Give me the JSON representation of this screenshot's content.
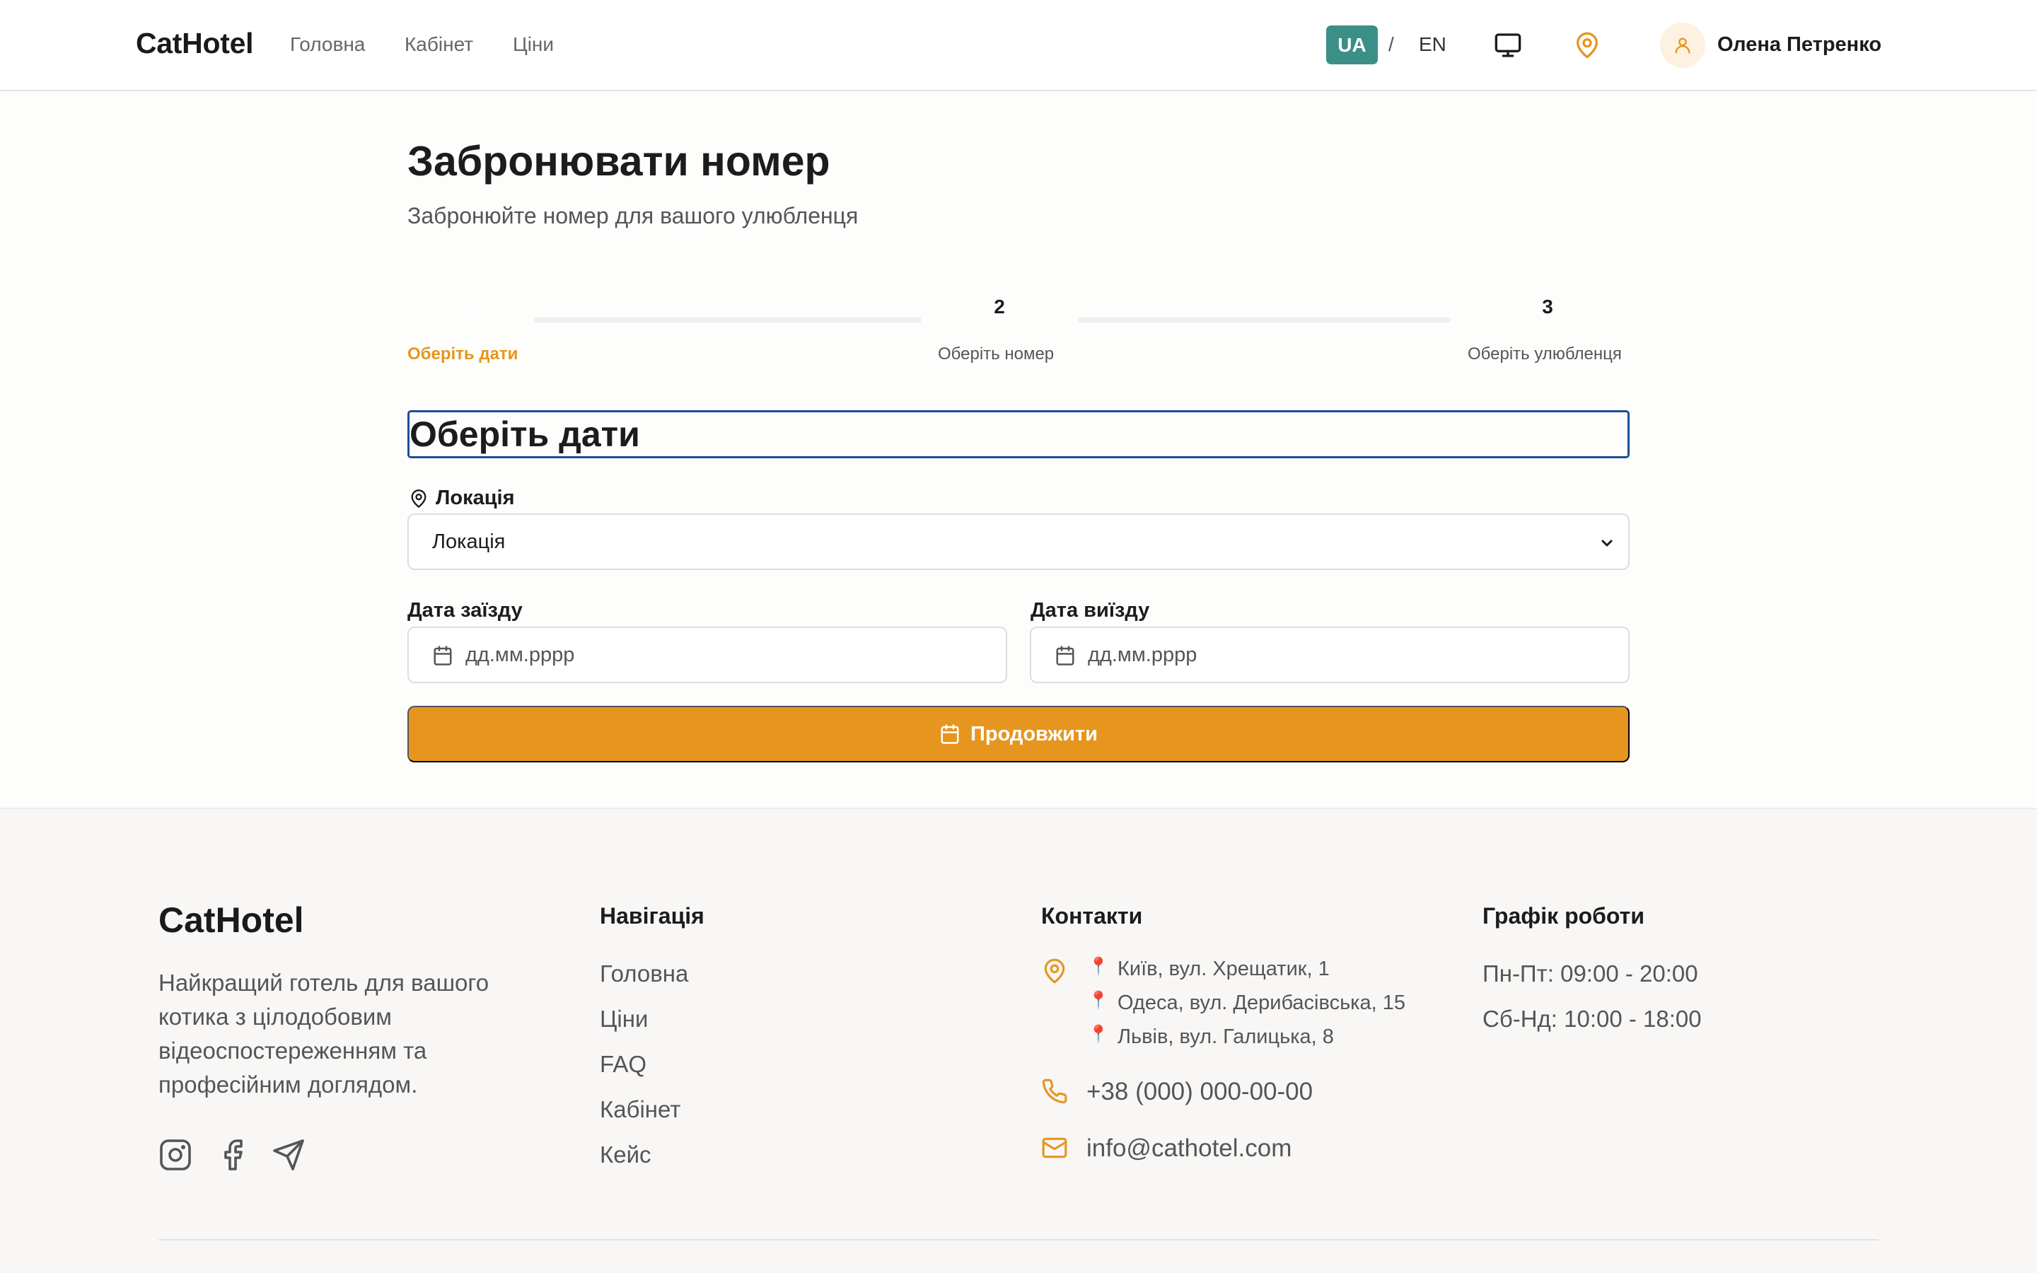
{
  "header": {
    "logo": "CatHotel",
    "nav": [
      "Головна",
      "Кабінет",
      "Ціни"
    ],
    "lang_active": "UA",
    "lang_sep": "/",
    "lang_other": "EN",
    "user_name": "Олена Петренко"
  },
  "page": {
    "title": "Забронювати номер",
    "subtitle": "Забронюйте номер для вашого улюбленця"
  },
  "steps": [
    {
      "number": "1",
      "label": "Оберіть дати",
      "active": true
    },
    {
      "number": "2",
      "label": "Оберіть номер",
      "active": false
    },
    {
      "number": "3",
      "label": "Оберіть улюбленця",
      "active": false
    }
  ],
  "form": {
    "section_title": "Оберіть дати",
    "location_label": "Локація",
    "location_value": "Локація",
    "checkin_label": "Дата заїзду",
    "checkin_placeholder": "дд.мм.рррр",
    "checkout_label": "Дата виїзду",
    "checkout_placeholder": "дд.мм.рррр",
    "submit_label": "Продовжити"
  },
  "footer": {
    "logo": "CatHotel",
    "description": "Найкращий готель для вашого котика з цілодобовим відеоспостереженням та професійним доглядом.",
    "nav_heading": "Навігація",
    "nav_links": [
      "Головна",
      "Ціни",
      "FAQ",
      "Кабінет",
      "Кейс"
    ],
    "contacts_heading": "Контакти",
    "addresses": [
      "Київ, вул. Хрещатик, 1",
      "Одеса, вул. Дерибасівська, 15",
      "Львів, вул. Галицька, 8"
    ],
    "phone": "+38 (000) 000-00-00",
    "email": "info@cathotel.com",
    "hours_heading": "Графік роботи",
    "hours": [
      "Пн-Пт: 09:00 - 20:00",
      "Сб-Нд: 10:00 - 18:00"
    ]
  },
  "colors": {
    "accent": "#e6961f",
    "lang_active_bg": "#3c8f86",
    "focus_border": "#1c4f98",
    "footer_bg": "#f8f7f6"
  }
}
